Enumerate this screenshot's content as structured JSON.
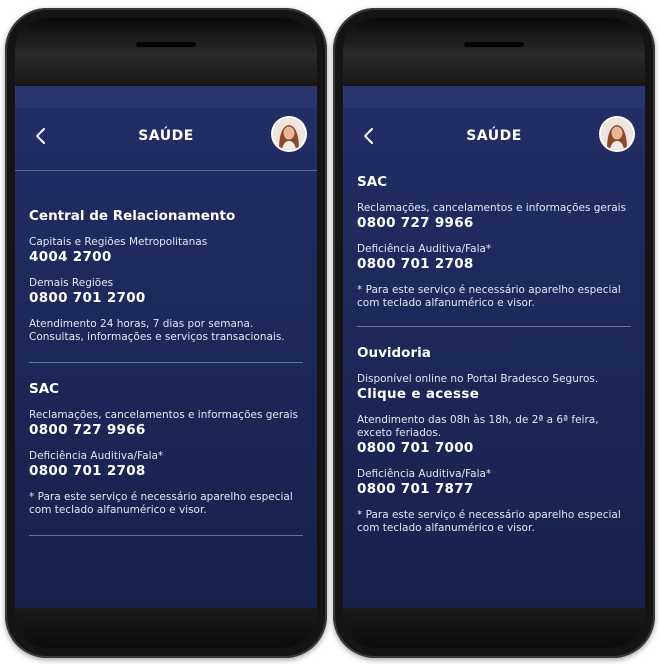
{
  "header": {
    "title": "SAÚDE"
  },
  "left": {
    "central": {
      "title": "Central de Relacionamento",
      "capitais_label": "Capitais e Regiões Metropolitanas",
      "capitais_phone": "4004 2700",
      "demais_label": "Demais Regiões",
      "demais_phone": "0800 701 2700",
      "note": "Atendimento 24 horas, 7 dias por semana. Consultas, informações e serviços transacionais."
    },
    "sac": {
      "title": "SAC",
      "reclamacoes_label": "Reclamações, cancelamentos e informações gerais",
      "reclamacoes_phone": "0800 727 9966",
      "deficiencia_label": "Deficiência Auditiva/Fala*",
      "deficiencia_phone": "0800 701 2708",
      "footnote": "* Para este serviço é necessário aparelho especial com teclado alfanumérico e visor."
    }
  },
  "right": {
    "sac": {
      "title": "SAC",
      "reclamacoes_label": "Reclamações, cancelamentos e informações gerais",
      "reclamacoes_phone": "0800 727 9966",
      "deficiencia_label": "Deficiência Auditiva/Fala*",
      "deficiencia_phone": "0800 701 2708",
      "footnote": "* Para este serviço é necessário aparelho especial com teclado alfanumérico e visor."
    },
    "ouvidoria": {
      "title": "Ouvidoria",
      "online_label": "Disponível online no Portal Bradesco Seguros.",
      "online_link": "Clique e acesse",
      "hours_label": "Atendimento das 08h às 18h, de 2ª a 6ª feira, exceto feriados.",
      "hours_phone": "0800 701 7000",
      "deficiencia_label": "Deficiência Auditiva/Fala*",
      "deficiencia_phone": "0800 701 7877",
      "footnote": "* Para este serviço é necessário aparelho especial com teclado alfanumérico e visor."
    }
  },
  "icons": {
    "back": "chevron-left-icon",
    "avatar": "user-avatar"
  },
  "colors": {
    "background_top": "#24306a",
    "background_bottom": "#17204a",
    "text": "#ffffff"
  }
}
